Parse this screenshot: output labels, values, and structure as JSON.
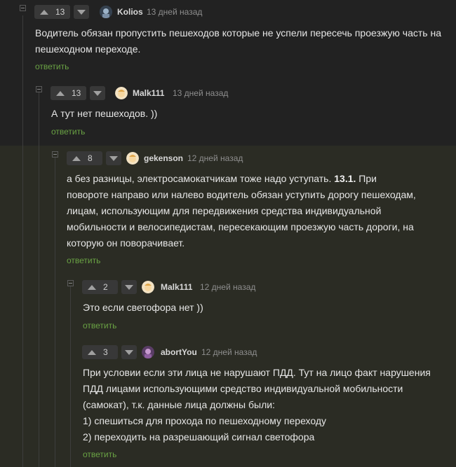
{
  "comments": [
    {
      "rating": "13",
      "user": "Kolios",
      "time": "13 дней назад",
      "text": "Водитель обязан пропустить пешеходов которые не успели пересечь проезжую часть на пешеходном переходе.",
      "reply": "ответить"
    },
    {
      "rating": "13",
      "user": "Malk111",
      "time": "13 дней назад",
      "text": "А тут нет пешеходов. ))",
      "reply": "ответить"
    },
    {
      "rating": "8",
      "user": "gekenson",
      "time": "12 дней назад",
      "text_before": "а без разницы, электросамокатчикам тоже надо уступать. ",
      "text_bold": "13.1.",
      "text_after": " При повороте направо или налево водитель обязан уступить дорогу пешеходам, лицам, использующим для передвижения средства индивидуальной мобильности и велосипедистам, пересекающим проезжую часть дороги, на которую он поворачивает.",
      "reply": "ответить"
    },
    {
      "rating": "2",
      "user": "Malk111",
      "time": "12 дней назад",
      "text": "Это если светофора нет ))",
      "reply": "ответить"
    },
    {
      "rating": "3",
      "user": "abortYou",
      "time": "12 дней назад",
      "lines": [
        "При условии если эти лица не нарушают ПДД. Тут на лицо факт нарушения",
        "ПДД лицами использующими средство индивидуальной мобильности",
        "(самокат), т.к. данные лица должны были:",
        "1) спешиться для прохода по пешеходному переходу",
        "2) переходить на разрешающий сигнал светофора"
      ],
      "reply": "ответить"
    }
  ],
  "colors": {
    "background": "#222222",
    "highlight": "#2b2c24",
    "reply": "#6aa344"
  }
}
